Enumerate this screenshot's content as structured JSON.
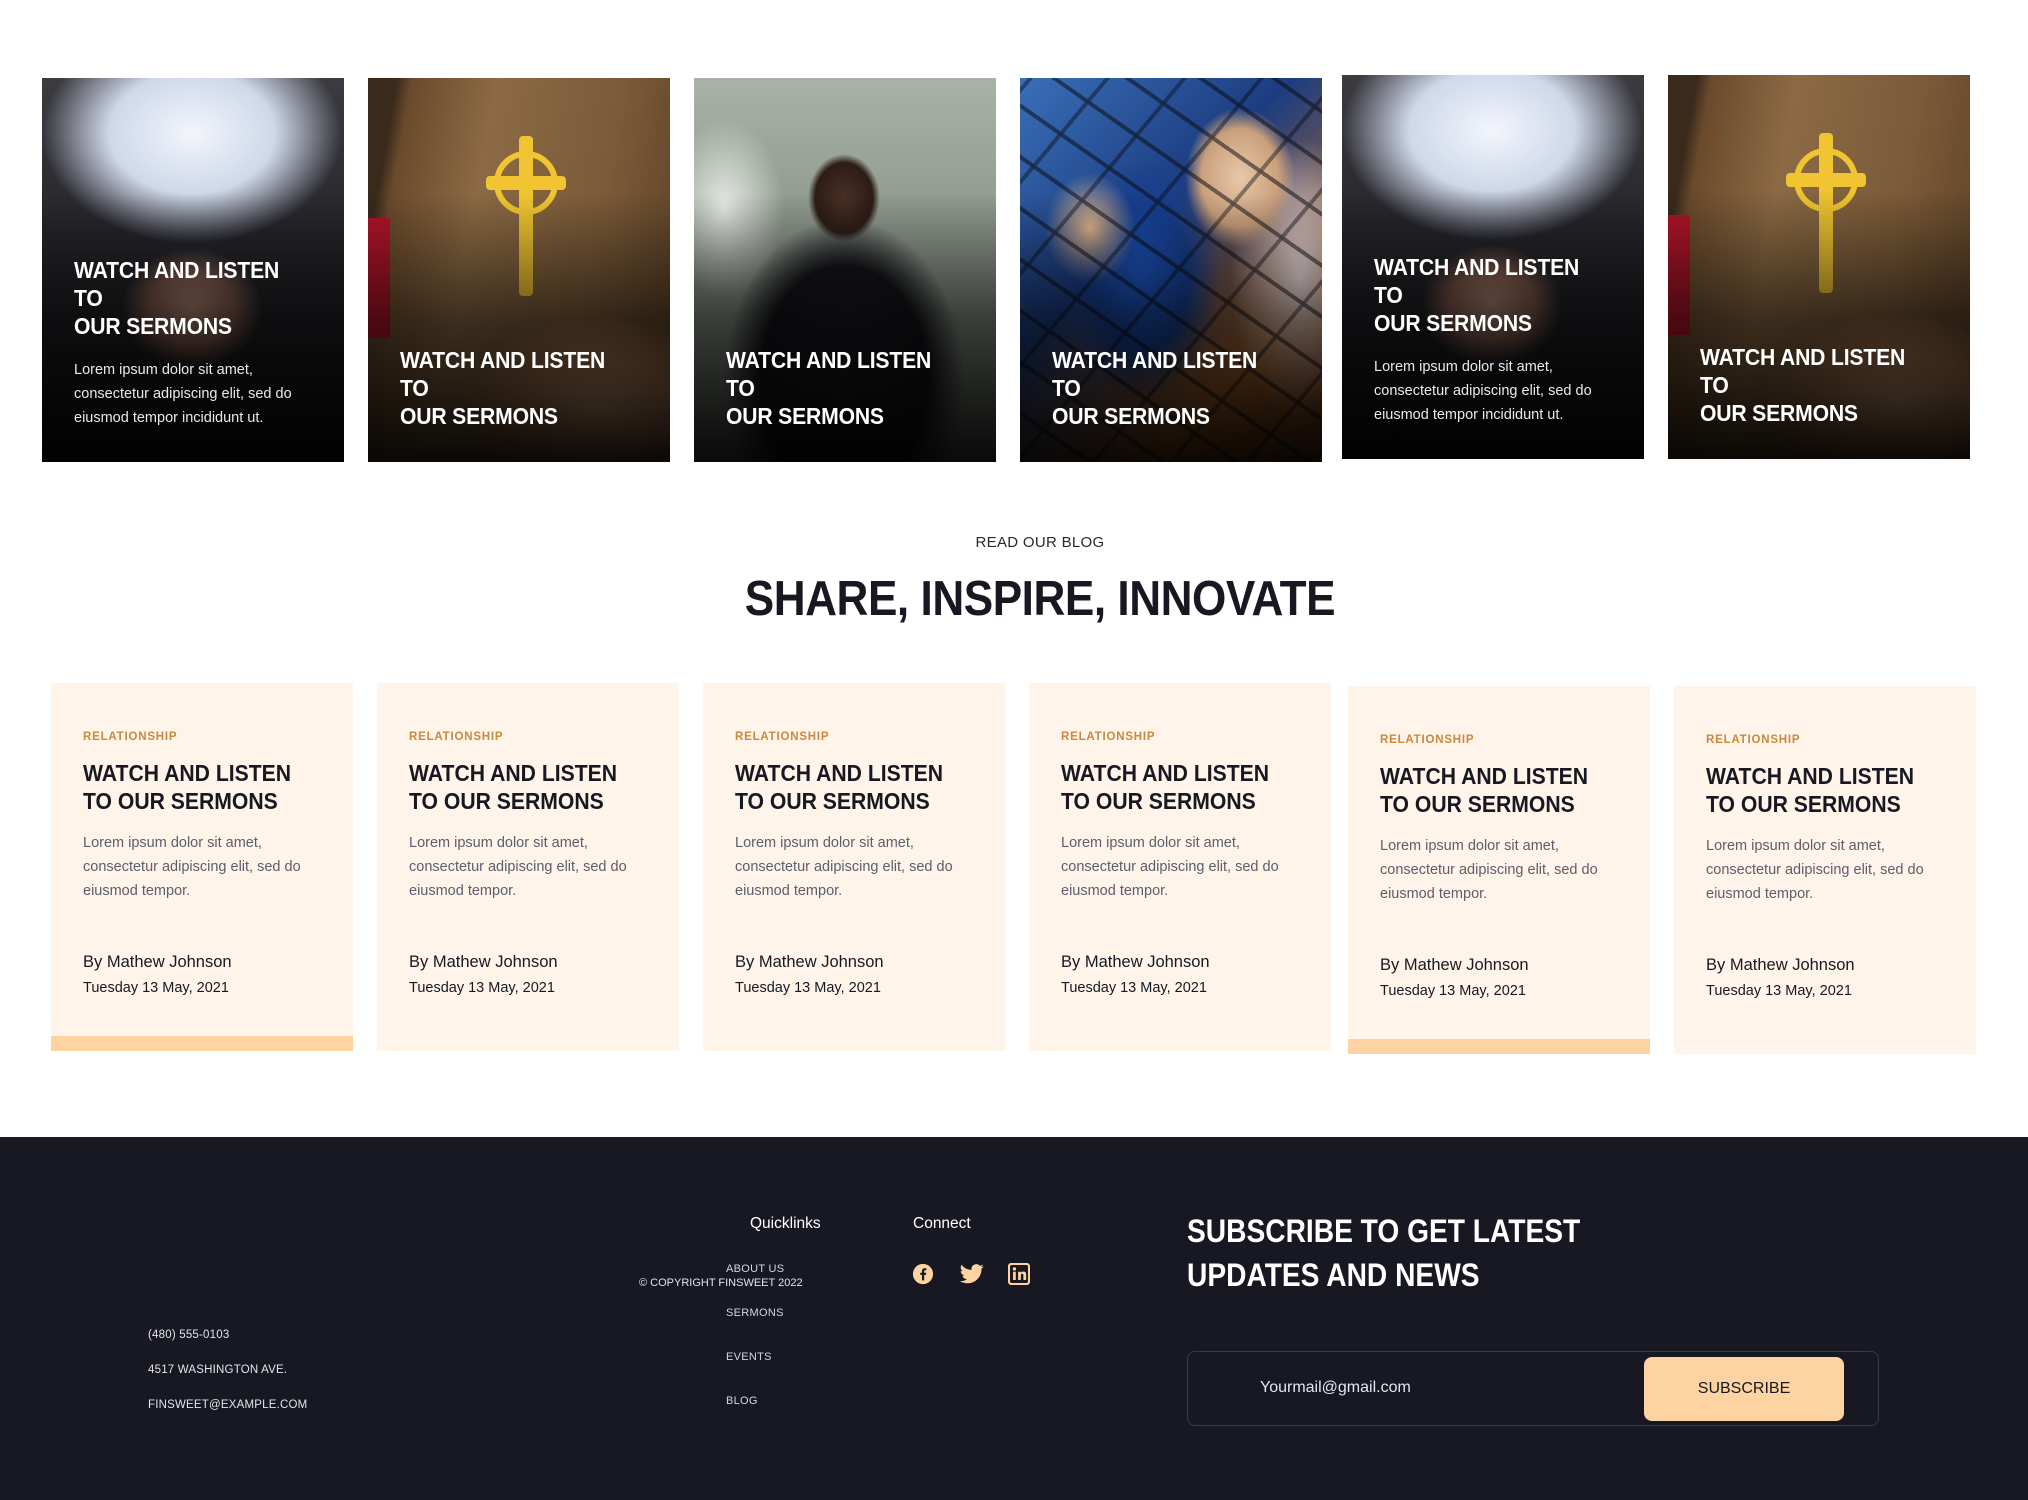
{
  "sermon_cards": [
    {
      "title": "WATCH AND LISTEN TO\nOUR SERMONS",
      "text": "Lorem ipsum dolor sit amet, consectetur adipiscing elit, sed do eiusmod tempor incididunt ut."
    },
    {
      "title": "WATCH AND LISTEN TO\nOUR SERMONS"
    },
    {
      "title": "WATCH AND LISTEN TO\nOUR SERMONS"
    },
    {
      "title": "WATCH AND LISTEN TO\nOUR SERMONS"
    },
    {
      "title": "WATCH AND LISTEN TO\nOUR SERMONS",
      "text": "Lorem ipsum dolor sit amet, consectetur adipiscing elit, sed do eiusmod tempor incididunt ut."
    },
    {
      "title": "WATCH AND LISTEN TO\nOUR SERMONS"
    }
  ],
  "blog": {
    "eyebrow": "READ OUR BLOG",
    "title": "SHARE, INSPIRE, INNOVATE",
    "posts": [
      {
        "category": "RELATIONSHIP",
        "title": "WATCH AND LISTEN\nTO OUR SERMONS",
        "excerpt": "Lorem ipsum dolor sit amet, consectetur adipiscing elit, sed do eiusmod tempor.",
        "author": "By Mathew Johnson",
        "date": "Tuesday 13 May, 2021"
      },
      {
        "category": "RELATIONSHIP",
        "title": "WATCH AND LISTEN\nTO OUR SERMONS",
        "excerpt": "Lorem ipsum dolor sit amet, consectetur adipiscing elit, sed do eiusmod tempor.",
        "author": "By Mathew Johnson",
        "date": "Tuesday 13 May, 2021"
      },
      {
        "category": "RELATIONSHIP",
        "title": "WATCH AND LISTEN\nTO OUR SERMONS",
        "excerpt": "Lorem ipsum dolor sit amet, consectetur adipiscing elit, sed do eiusmod tempor.",
        "author": "By Mathew Johnson",
        "date": "Tuesday 13 May, 2021"
      },
      {
        "category": "RELATIONSHIP",
        "title": "WATCH AND LISTEN\nTO OUR SERMONS",
        "excerpt": "Lorem ipsum dolor sit amet, consectetur adipiscing elit, sed do eiusmod tempor.",
        "author": "By Mathew Johnson",
        "date": "Tuesday 13 May, 2021"
      },
      {
        "category": "RELATIONSHIP",
        "title": "WATCH AND LISTEN\nTO OUR SERMONS",
        "excerpt": "Lorem ipsum dolor sit amet, consectetur adipiscing elit, sed do eiusmod tempor.",
        "author": "By Mathew Johnson",
        "date": "Tuesday 13 May, 2021"
      },
      {
        "category": "RELATIONSHIP",
        "title": "WATCH AND LISTEN\nTO OUR SERMONS",
        "excerpt": "Lorem ipsum dolor sit amet, consectetur adipiscing elit, sed do eiusmod tempor.",
        "author": "By Mathew Johnson",
        "date": "Tuesday 13 May, 2021"
      }
    ]
  },
  "footer": {
    "phone": "(480) 555-0103",
    "address": "4517 WASHINGTON AVE.",
    "email": "FINSWEET@EXAMPLE.COM",
    "copyright": "© COPYRIGHT FINSWEET 2022",
    "quicklinks_title": "Quicklinks",
    "quicklinks": [
      "ABOUT US",
      "SERMONS",
      "EVENTS",
      "BLOG"
    ],
    "connect_title": "Connect",
    "social_icons": [
      "facebook-icon",
      "twitter-icon",
      "linkedin-icon"
    ],
    "subscribe_title": "SUBSCRIBE TO GET LATEST UPDATES AND NEWS",
    "email_placeholder": "Yourmail@gmail.com",
    "subscribe_button": "SUBSCRIBE"
  },
  "colors": {
    "dark": "#171822",
    "accent": "#fcd3a1",
    "card_bg": "#fff4e9",
    "category": "#c9893e"
  }
}
